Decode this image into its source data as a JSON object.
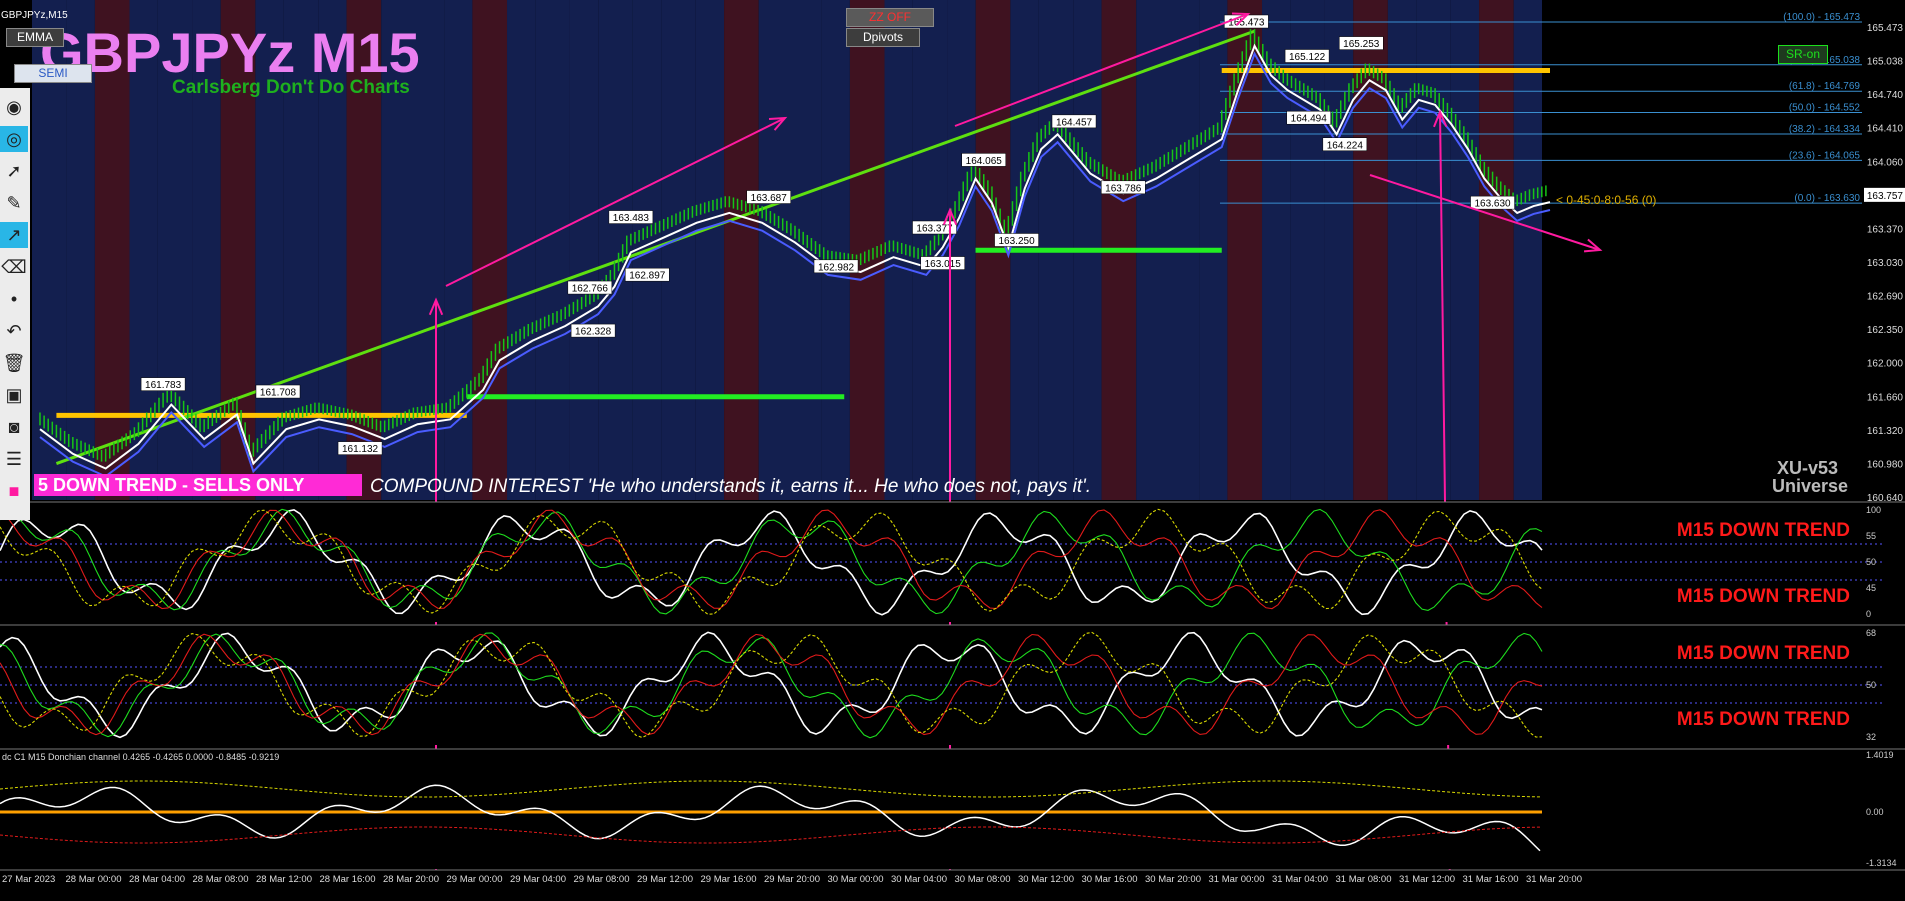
{
  "window": {
    "title": "GBPJPYz,M15"
  },
  "buttons": {
    "emma": "EMMA",
    "semi": "SEMI",
    "zz_off": "ZZ OFF",
    "dpivots": "Dpivots",
    "sr_on": "SR-on"
  },
  "header": {
    "symbol_title": "GBPJPYz M15",
    "subtitle": "Carlsberg Don't Do Charts"
  },
  "banner": {
    "trend_badge": "5  DOWN TREND - SELLS ONLY",
    "quote": "COMPOUND INTEREST  'He who understands it, earns it... He who does not, pays it'."
  },
  "branding": {
    "version": "XU-v53",
    "name": "Universe"
  },
  "fib_overlay": "< 0-45:0-8:0-56 (0)",
  "colors": {
    "bull_bg": "#131f4f",
    "bear_bg": "#3f1220",
    "candle": "#16c516",
    "trendline": "#5ee010",
    "support": "#22ee22",
    "resistance": "#ffc400",
    "arrow": "#ff1aa0",
    "fib": "#3a8fd0",
    "alert": "#ff1a1a"
  },
  "toolbar": {
    "icons": [
      "pin-icon",
      "eye-icon",
      "cursor-icon",
      "pencil-icon",
      "line-tool-icon",
      "eraser-icon",
      "dot-icon",
      "undo-icon",
      "trash-icon",
      "bus-icon",
      "camera-icon",
      "list-icon",
      "color-swatch-icon"
    ]
  },
  "chart_data": [
    {
      "type": "line",
      "title": "GBPJPYz M15",
      "ylim": [
        160.64,
        165.473
      ],
      "y_ticks": [
        "165.473",
        "165.038",
        "164.740",
        "164.410",
        "164.060",
        "163.757",
        "163.370",
        "163.030",
        "162.690",
        "162.350",
        "162.000",
        "161.660",
        "161.320",
        "160.980",
        "160.640"
      ],
      "current_price": "163.757",
      "x_ticks": [
        "27 Mar 2023",
        "28 Mar 00:00",
        "28 Mar 04:00",
        "28 Mar 08:00",
        "28 Mar 12:00",
        "28 Mar 16:00",
        "28 Mar 20:00",
        "29 Mar 00:00",
        "29 Mar 04:00",
        "29 Mar 08:00",
        "29 Mar 12:00",
        "29 Mar 16:00",
        "29 Mar 20:00",
        "30 Mar 00:00",
        "30 Mar 04:00",
        "30 Mar 08:00",
        "30 Mar 12:00",
        "30 Mar 16:00",
        "30 Mar 20:00",
        "31 Mar 00:00",
        "31 Mar 04:00",
        "31 Mar 08:00",
        "31 Mar 12:00",
        "31 Mar 16:00",
        "31 Mar 20:00"
      ],
      "price_path": [
        [
          0,
          161.45
        ],
        [
          2,
          161.2
        ],
        [
          4,
          161.05
        ],
        [
          6,
          161.3
        ],
        [
          8,
          161.7
        ],
        [
          10,
          161.35
        ],
        [
          12,
          161.6
        ],
        [
          13,
          161.1
        ],
        [
          15,
          161.45
        ],
        [
          17,
          161.55
        ],
        [
          19,
          161.48
        ],
        [
          21,
          161.35
        ],
        [
          23,
          161.5
        ],
        [
          25,
          161.55
        ],
        [
          26,
          161.7
        ],
        [
          27,
          161.85
        ],
        [
          28,
          162.15
        ],
        [
          30,
          162.35
        ],
        [
          32,
          162.5
        ],
        [
          34,
          162.7
        ],
        [
          35,
          162.9
        ],
        [
          36,
          163.25
        ],
        [
          38,
          163.4
        ],
        [
          40,
          163.55
        ],
        [
          42,
          163.65
        ],
        [
          44,
          163.55
        ],
        [
          46,
          163.35
        ],
        [
          48,
          163.1
        ],
        [
          50,
          163.05
        ],
        [
          52,
          163.2
        ],
        [
          54,
          163.1
        ],
        [
          55,
          163.3
        ],
        [
          56,
          163.6
        ],
        [
          57,
          164.0
        ],
        [
          58,
          163.75
        ],
        [
          59,
          163.3
        ],
        [
          60,
          163.9
        ],
        [
          61,
          164.3
        ],
        [
          62,
          164.45
        ],
        [
          64,
          164.05
        ],
        [
          66,
          163.85
        ],
        [
          68,
          164.0
        ],
        [
          70,
          164.2
        ],
        [
          72,
          164.4
        ],
        [
          73,
          164.9
        ],
        [
          74,
          165.35
        ],
        [
          75,
          165.05
        ],
        [
          76,
          164.9
        ],
        [
          78,
          164.7
        ],
        [
          79,
          164.45
        ],
        [
          80,
          164.8
        ],
        [
          81,
          165.0
        ],
        [
          82,
          164.9
        ],
        [
          83,
          164.6
        ],
        [
          84,
          164.8
        ],
        [
          85,
          164.75
        ],
        [
          86,
          164.55
        ],
        [
          87,
          164.3
        ],
        [
          88,
          164.0
        ],
        [
          89,
          163.8
        ],
        [
          90,
          163.65
        ],
        [
          91,
          163.72
        ],
        [
          92,
          163.76
        ]
      ],
      "swing_labels": [
        {
          "x": 7.5,
          "v": 161.783,
          "text": "161.783"
        },
        {
          "x": 14.5,
          "v": 161.708,
          "text": "161.708"
        },
        {
          "x": 19.5,
          "v": 161.132,
          "text": "161.132"
        },
        {
          "x": 33.5,
          "v": 162.766,
          "text": "162.766"
        },
        {
          "x": 33.7,
          "v": 162.328,
          "text": "162.328"
        },
        {
          "x": 37,
          "v": 162.897,
          "text": "162.897"
        },
        {
          "x": 36,
          "v": 163.483,
          "text": "163.483"
        },
        {
          "x": 44.4,
          "v": 163.687,
          "text": "163.687"
        },
        {
          "x": 48.5,
          "v": 162.982,
          "text": "162.982"
        },
        {
          "x": 54.5,
          "v": 163.377,
          "text": "163.377"
        },
        {
          "x": 55,
          "v": 163.015,
          "text": "163.015"
        },
        {
          "x": 57.5,
          "v": 164.065,
          "text": "164.065"
        },
        {
          "x": 59.5,
          "v": 163.25,
          "text": "163.250"
        },
        {
          "x": 63,
          "v": 164.457,
          "text": "164.457"
        },
        {
          "x": 66,
          "v": 163.786,
          "text": "163.786"
        },
        {
          "x": 73.5,
          "v": 165.473,
          "text": "165.473"
        },
        {
          "x": 77.2,
          "v": 165.122,
          "text": "165.122"
        },
        {
          "x": 77.3,
          "v": 164.494,
          "text": "164.494"
        },
        {
          "x": 80.5,
          "v": 165.253,
          "text": "165.253"
        },
        {
          "x": 79.5,
          "v": 164.224,
          "text": "164.224"
        },
        {
          "x": 88.5,
          "v": 163.63,
          "text": "163.630"
        }
      ],
      "fib_levels": [
        {
          "v": 165.473,
          "text": "(100.0) - 165.473"
        },
        {
          "v": 165.038,
          "text": "(76.4) - 165.038"
        },
        {
          "v": 164.769,
          "text": "(61.8) - 164.769"
        },
        {
          "v": 164.552,
          "text": "(50.0) - 164.552"
        },
        {
          "v": 164.334,
          "text": "(38.2) - 164.334"
        },
        {
          "v": 164.065,
          "text": "(23.6) - 164.065"
        },
        {
          "v": 163.63,
          "text": "(0.0) - 163.630"
        }
      ],
      "trendlines": {
        "rising_green": [
          [
            1,
            160.98
          ],
          [
            74,
            165.38
          ]
        ]
      },
      "support_lines": [
        [
          26,
          161.66,
          49
        ],
        [
          57,
          163.15,
          72
        ]
      ],
      "resistance_lines": [
        [
          72,
          164.98,
          92
        ],
        [
          1,
          161.47,
          26
        ]
      ]
    },
    {
      "type": "line",
      "panel": "oscillator-1",
      "ylim": [
        0,
        100
      ],
      "y_ticks": [
        "100",
        "55",
        "50",
        "45",
        "0"
      ],
      "alerts": [
        "M15 DOWN TREND",
        "M15 DOWN TREND"
      ]
    },
    {
      "type": "line",
      "panel": "oscillator-2",
      "ylim": [
        0,
        100
      ],
      "y_ticks": [
        "68",
        "50",
        "32"
      ],
      "alerts": [
        "M15 DOWN TREND",
        "M15 DOWN TREND"
      ]
    },
    {
      "type": "line",
      "panel": "donchian",
      "title": "dc C1 M15 Donchian channel 0.4265 -0.4265 0.0000 -0.8485 -0.9219",
      "ylim": [
        -1.3134,
        1.4019
      ],
      "y_ticks": [
        "1.4019",
        "0.00",
        "-1.3134"
      ]
    }
  ]
}
